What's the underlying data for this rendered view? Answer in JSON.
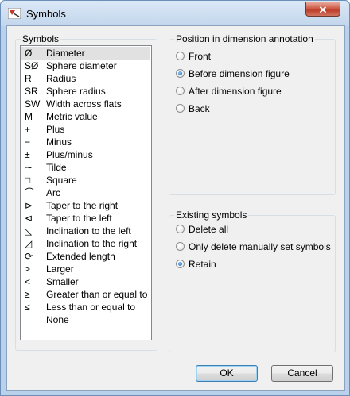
{
  "window": {
    "title": "Symbols",
    "close_label": "✕"
  },
  "symbols_group": {
    "label": "Symbols",
    "items": [
      {
        "symbol": "Ø",
        "label": "Diameter",
        "selected": true
      },
      {
        "symbol": "SØ",
        "label": "Sphere diameter"
      },
      {
        "symbol": "R",
        "label": "Radius"
      },
      {
        "symbol": "SR",
        "label": "Sphere radius"
      },
      {
        "symbol": "SW",
        "label": "Width across flats"
      },
      {
        "symbol": "M",
        "label": "Metric value"
      },
      {
        "symbol": "+",
        "label": "Plus"
      },
      {
        "symbol": "−",
        "label": "Minus"
      },
      {
        "symbol": "±",
        "label": "Plus/minus"
      },
      {
        "symbol": "∼",
        "label": "Tilde"
      },
      {
        "symbol": "□",
        "label": "Square"
      },
      {
        "symbol": "⌒",
        "label": "Arc"
      },
      {
        "symbol": "⊳",
        "label": "Taper to the right"
      },
      {
        "symbol": "⊲",
        "label": "Taper to the left"
      },
      {
        "symbol": "◺",
        "label": "Inclination to the left"
      },
      {
        "symbol": "◿",
        "label": "Inclination to the right"
      },
      {
        "symbol": "⟳",
        "label": "Extended length"
      },
      {
        "symbol": ">",
        "label": "Larger"
      },
      {
        "symbol": "<",
        "label": "Smaller"
      },
      {
        "symbol": "≥",
        "label": "Greater than or equal to"
      },
      {
        "symbol": "≤",
        "label": "Less than or equal to"
      },
      {
        "symbol": "",
        "label": "None"
      }
    ]
  },
  "position_group": {
    "label": "Position in dimension annotation",
    "options": [
      {
        "label": "Front",
        "checked": false
      },
      {
        "label": "Before dimension figure",
        "checked": true
      },
      {
        "label": "After dimension figure",
        "checked": false
      },
      {
        "label": "Back",
        "checked": false
      }
    ]
  },
  "existing_group": {
    "label": "Existing symbols",
    "options": [
      {
        "label": "Delete all",
        "checked": false
      },
      {
        "label": "Only delete manually set symbols",
        "checked": false
      },
      {
        "label": "Retain",
        "checked": true
      }
    ]
  },
  "buttons": {
    "ok": "OK",
    "cancel": "Cancel"
  },
  "colors": {
    "selection": "#e1e1e1",
    "title_bar": "#c2d6ec",
    "close_button": "#c9513b"
  }
}
